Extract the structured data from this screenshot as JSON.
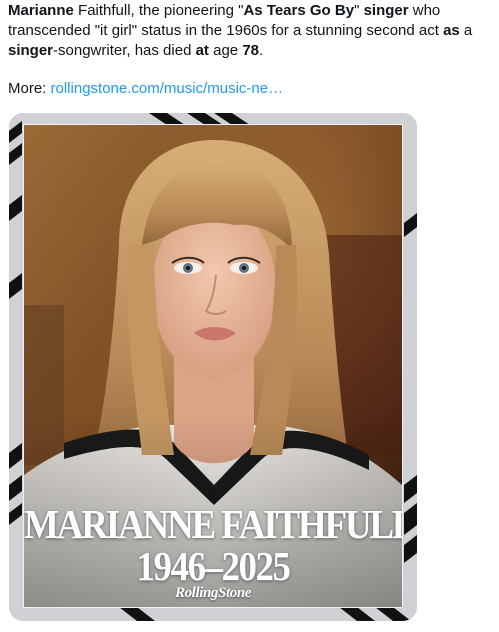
{
  "tweet": {
    "parts": [
      {
        "text": "Marianne",
        "bold": true
      },
      {
        "text": " Faithfull, the pioneering \"",
        "bold": false
      },
      {
        "text": "As Tears Go By",
        "bold": true
      },
      {
        "text": "\" ",
        "bold": false
      },
      {
        "text": "singer",
        "bold": true
      },
      {
        "text": " who transcended \"it girl\" status in the 1960s for a stunning second act ",
        "bold": false
      },
      {
        "text": "as",
        "bold": true
      },
      {
        "text": " a ",
        "bold": false
      },
      {
        "text": "singer",
        "bold": true
      },
      {
        "text": "-songwriter, has died ",
        "bold": false
      },
      {
        "text": "at",
        "bold": true
      },
      {
        "text": " age ",
        "bold": false
      },
      {
        "text": "78",
        "bold": true
      },
      {
        "text": ".",
        "bold": false
      }
    ],
    "more_label": "More: ",
    "more_link": "rollingstone.com/music/music-ne…"
  },
  "media": {
    "headline_name": "MARIANNE FAITHFULL",
    "headline_years": "1946–2025",
    "brand": "RollingStone",
    "colors": {
      "frame": "#cfd1d4",
      "stripe": "#111111",
      "background_warm": "#8a5a2b",
      "hair": "#c79a63",
      "skin": "#e8b79a",
      "shirt": "#e9e6e1"
    }
  }
}
